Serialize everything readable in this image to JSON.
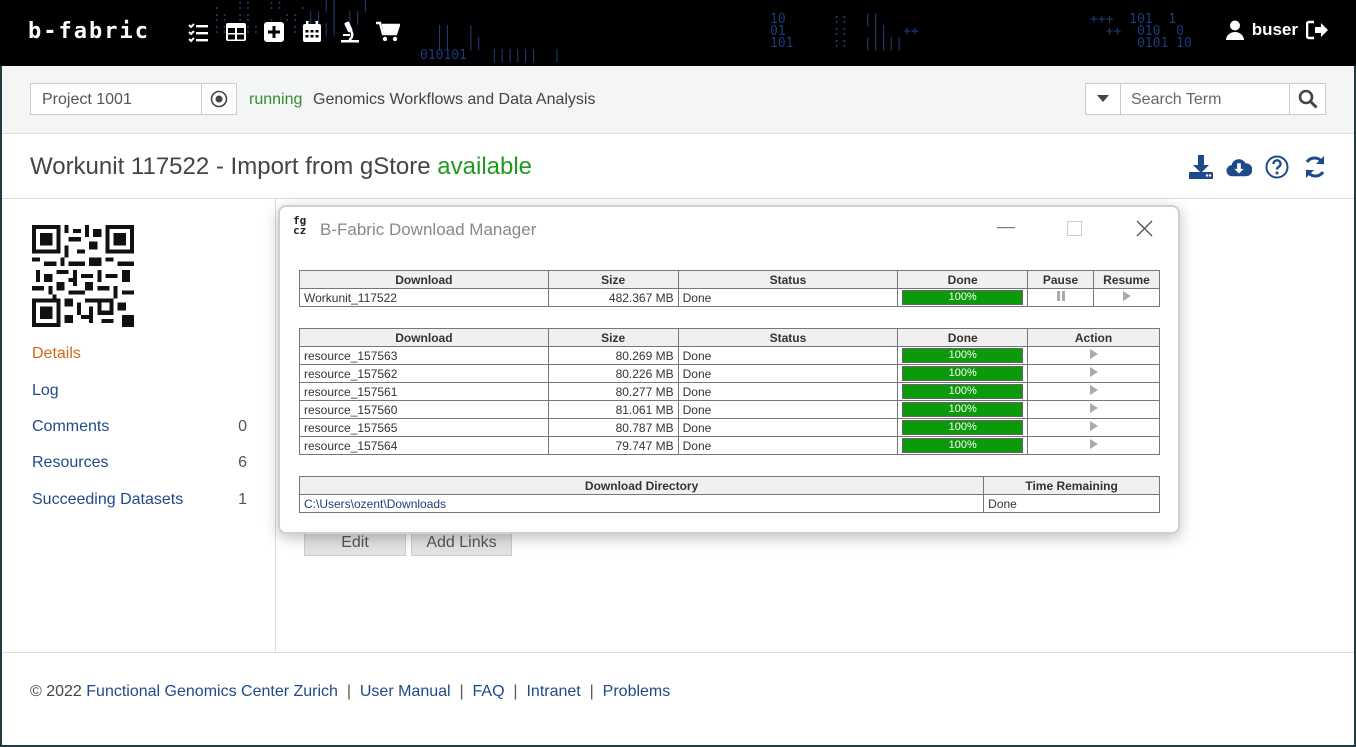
{
  "topbar": {
    "logo": "b-fabric",
    "user": "buser"
  },
  "project": {
    "input_value": "Project 1001",
    "status": "running",
    "name": "Genomics Workflows and Data Analysis"
  },
  "search": {
    "placeholder": "Search Term"
  },
  "page": {
    "title": "Workunit 117522 - Import from gStore",
    "state": "available"
  },
  "sidebar": {
    "items": [
      {
        "label": "Details",
        "count": ""
      },
      {
        "label": "Log",
        "count": ""
      },
      {
        "label": "Comments",
        "count": "0"
      },
      {
        "label": "Resources",
        "count": "6"
      },
      {
        "label": "Succeeding Datasets",
        "count": "1"
      }
    ]
  },
  "buttons": {
    "edit": "Edit",
    "add_links": "Add Links"
  },
  "footer": {
    "copyright": "© 2022 ",
    "org": "Functional Genomics Center Zurich",
    "links": [
      "User Manual",
      "FAQ",
      "Intranet",
      "Problems"
    ],
    "separator": "|"
  },
  "dialog": {
    "title": "B-Fabric Download Manager",
    "logo": "fg\ncz",
    "main_table": {
      "headers": [
        "Download",
        "Size",
        "Status",
        "Done",
        "Pause",
        "Resume"
      ],
      "row": {
        "download": "Workunit_117522",
        "size": "482.367 MB",
        "status": "Done",
        "done_label": "100%",
        "done": 1.0
      }
    },
    "files_table": {
      "headers": [
        "Download",
        "Size",
        "Status",
        "Done",
        "Action"
      ],
      "rows": [
        {
          "download": "resource_157563",
          "size": "80.269 MB",
          "status": "Done",
          "done_label": "100%",
          "done": 1.0
        },
        {
          "download": "resource_157562",
          "size": "80.226 MB",
          "status": "Done",
          "done_label": "100%",
          "done": 1.0
        },
        {
          "download": "resource_157561",
          "size": "80.277 MB",
          "status": "Done",
          "done_label": "100%",
          "done": 1.0
        },
        {
          "download": "resource_157560",
          "size": "81.061 MB",
          "status": "Done",
          "done_label": "100%",
          "done": 1.0
        },
        {
          "download": "resource_157565",
          "size": "80.787 MB",
          "status": "Done",
          "done_label": "100%",
          "done": 1.0
        },
        {
          "download": "resource_157564",
          "size": "79.747 MB",
          "status": "Done",
          "done_label": "100%",
          "done": 1.0
        }
      ]
    },
    "dir_table": {
      "headers": [
        "Download Directory",
        "Time Remaining"
      ],
      "directory": "C:\\Users\\ozent\\Downloads",
      "time_remaining": "Done"
    }
  },
  "colors": {
    "running": "#2f8f2f",
    "available": "#1f9a1f",
    "link": "#1f4a8a",
    "active_nav": "#d2691e",
    "progress": "#0a9a0a"
  }
}
